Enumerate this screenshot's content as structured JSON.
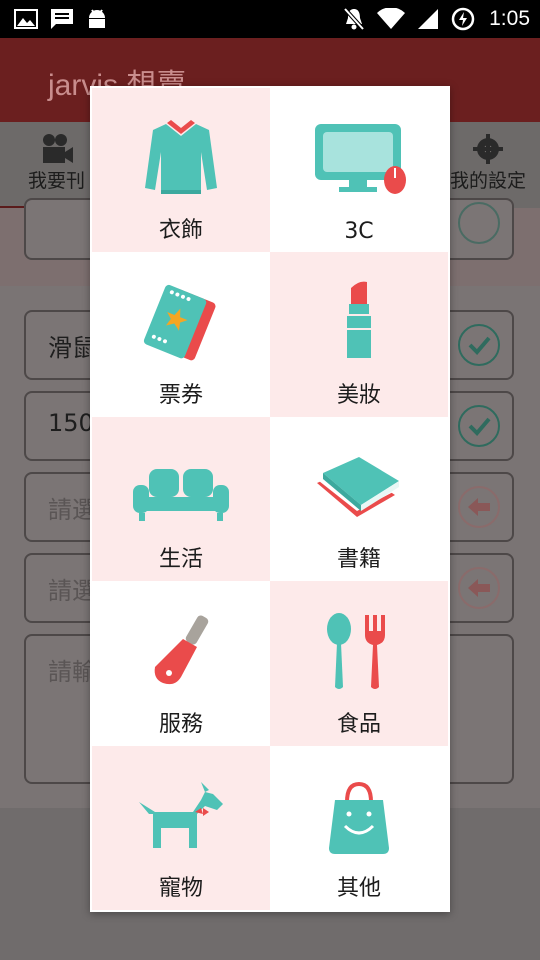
{
  "status_bar": {
    "time": "1:05"
  },
  "app": {
    "title": "jarvis 想賣"
  },
  "tabs": {
    "left_label": "我要刊",
    "right_label": "我的設定"
  },
  "form": {
    "fields": [
      {
        "text": "滑鼠",
        "state": "check"
      },
      {
        "text": "150",
        "state": "check"
      },
      {
        "text": "請選",
        "state": "arrow"
      },
      {
        "text": "請選",
        "state": "arrow"
      },
      {
        "text": "請輸",
        "state": "none"
      }
    ]
  },
  "dialog": {
    "categories": [
      {
        "label": "衣飾",
        "icon": "sweater-icon"
      },
      {
        "label": "3C",
        "icon": "computer-monitor-icon"
      },
      {
        "label": "票券",
        "icon": "tickets-icon"
      },
      {
        "label": "美妝",
        "icon": "lipstick-icon"
      },
      {
        "label": "生活",
        "icon": "sofa-icon"
      },
      {
        "label": "書籍",
        "icon": "books-icon"
      },
      {
        "label": "服務",
        "icon": "tool-icon"
      },
      {
        "label": "食品",
        "icon": "utensils-icon"
      },
      {
        "label": "寵物",
        "icon": "dog-icon"
      },
      {
        "label": "其他",
        "icon": "shopping-bag-icon"
      }
    ]
  },
  "colors": {
    "teal": "#4fc2b6",
    "red": "#ea4b4b",
    "pink_cell": "#fdeaea"
  }
}
